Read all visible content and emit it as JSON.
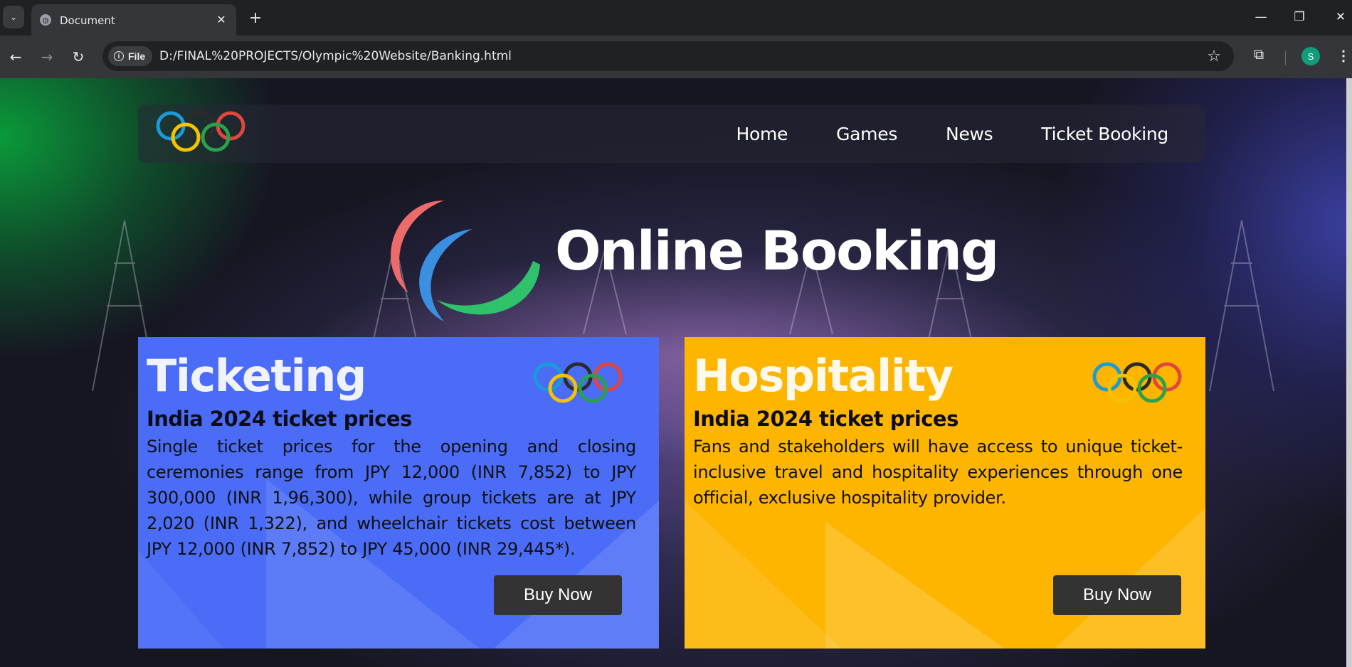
{
  "browser": {
    "tab_title": "Document",
    "address_chip": "File",
    "url": "D:/FINAL%20PROJECTS/Olympic%20Website/Banking.html",
    "profile_initial": "S"
  },
  "page": {
    "nav": {
      "links": [
        "Home",
        "Games",
        "News",
        "Ticket Booking"
      ]
    },
    "hero_title": "Online Booking",
    "ticketing": {
      "title": "Ticketing",
      "subtitle": "India 2024 ticket prices",
      "body": "Single ticket prices for the opening and closing ceremonies range from JPY 12,000 (INR 7,852) to JPY 300,000 (INR 1,96,300), while group tickets are at JPY 2,020 (INR 1,322), and wheelchair tickets cost between JPY 12,000 (INR 7,852) to JPY 45,000 (INR 29,445*).",
      "button": "Buy Now",
      "color": "#4a6cf7"
    },
    "hospitality": {
      "title": "Hospitality",
      "subtitle": "India 2024 ticket prices",
      "body": "Fans and stakeholders will have access to unique ticket-inclusive travel and hospitality experiences through one official, exclusive hospitality provider.",
      "button": "Buy Now",
      "color": "#fdb500"
    }
  }
}
